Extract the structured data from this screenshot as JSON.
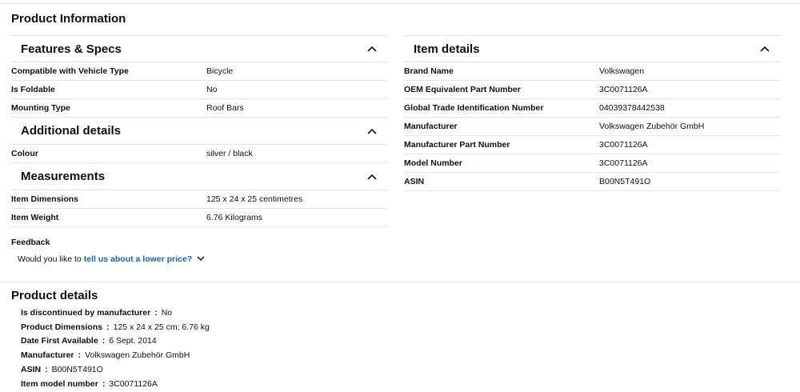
{
  "page_title": "Product Information",
  "features": {
    "title": "Features & Specs",
    "rows": [
      {
        "label": "Compatible with Vehicle Type",
        "value": "Bicycle"
      },
      {
        "label": "Is Foldable",
        "value": "No"
      },
      {
        "label": "Mounting Type",
        "value": "Roof Bars"
      }
    ]
  },
  "additional": {
    "title": "Additional details",
    "rows": [
      {
        "label": "Colour",
        "value": "silver / black"
      }
    ]
  },
  "measurements": {
    "title": "Measurements",
    "rows": [
      {
        "label": "Item Dimensions",
        "value": "125 x 24 x 25 centimetres"
      },
      {
        "label": "Item Weight",
        "value": "6.76 Kilograms"
      }
    ]
  },
  "item_details": {
    "title": "Item details",
    "rows": [
      {
        "label": "Brand Name",
        "value": "Volkswagen"
      },
      {
        "label": "OEM Equivalent Part Number",
        "value": "3C0071126A"
      },
      {
        "label": "Global Trade Identification Number",
        "value": "04039378442538"
      },
      {
        "label": "Manufacturer",
        "value": "Volkswagen Zubehör GmbH"
      },
      {
        "label": "Manufacturer Part Number",
        "value": "3C0071126A"
      },
      {
        "label": "Model Number",
        "value": "3C0071126A"
      },
      {
        "label": "ASIN",
        "value": "B00N5T491O"
      }
    ]
  },
  "feedback": {
    "title": "Feedback",
    "prompt": "Would you like to",
    "link": "tell us about a lower price?"
  },
  "product_details": {
    "title": "Product details",
    "separator": ":",
    "items": [
      {
        "label": "Is discontinued by manufacturer",
        "value": "No"
      },
      {
        "label": "Product Dimensions",
        "value": "125 x 24 x 25 cm; 6.76 kg"
      },
      {
        "label": "Date First Available",
        "value": "6 Sept. 2014"
      },
      {
        "label": "Manufacturer",
        "value": "Volkswagen Zubehör GmbH"
      },
      {
        "label": "ASIN",
        "value": "B00N5T491O"
      },
      {
        "label": "Item model number",
        "value": "3C0071126A"
      }
    ]
  },
  "icons": {
    "collapse": "chevron-up-icon",
    "expand": "chevron-down-icon"
  }
}
